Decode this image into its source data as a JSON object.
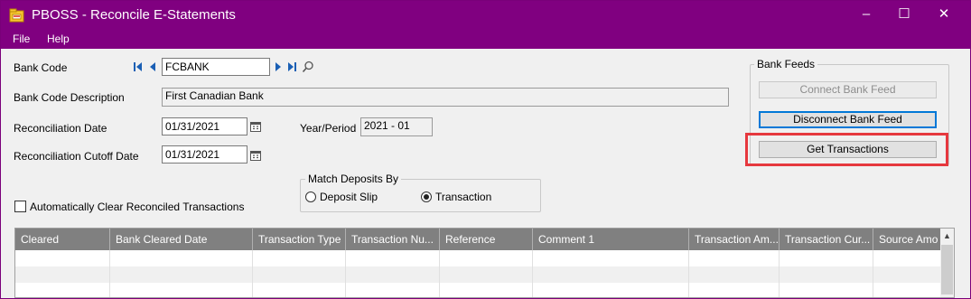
{
  "window": {
    "title": "PBOSS - Reconcile E-Statements",
    "controls": {
      "minimize": "–",
      "maximize": "☐",
      "close": "✕"
    }
  },
  "menu": {
    "file": "File",
    "help": "Help"
  },
  "form": {
    "bank_code_label": "Bank Code",
    "bank_code_value": "FCBANK",
    "bank_code_desc_label": "Bank Code Description",
    "bank_code_desc_value": "First Canadian Bank",
    "recon_date_label": "Reconciliation Date",
    "recon_date_value": "01/31/2021",
    "year_period_label": "Year/Period",
    "year_period_value": "2021 - 01",
    "cutoff_label": "Reconciliation Cutoff Date",
    "cutoff_value": "01/31/2021",
    "auto_clear_label": "Automatically Clear Reconciled Transactions",
    "auto_clear_checked": false
  },
  "match_deposits": {
    "title": "Match Deposits By",
    "options": [
      "Deposit Slip",
      "Transaction"
    ],
    "selected": "Transaction"
  },
  "bank_feeds": {
    "title": "Bank Feeds",
    "connect": "Connect Bank Feed",
    "disconnect": "Disconnect Bank Feed",
    "get_transactions": "Get Transactions"
  },
  "grid": {
    "columns": [
      "Cleared",
      "Bank Cleared Date",
      "Transaction Type",
      "Transaction Nu...",
      "Reference",
      "Comment 1",
      "Transaction Am...",
      "Transaction Cur...",
      "Source Amo"
    ]
  },
  "colors": {
    "titlebar": "#800080",
    "highlight": "#e6383e",
    "focus": "#0078d7",
    "grid_header": "#808080"
  },
  "icons": {
    "app": "app-icon",
    "first": "first-record-icon",
    "prev": "previous-record-icon",
    "next": "next-record-icon",
    "last": "last-record-icon",
    "finder": "finder-magnifier-icon",
    "calendar": "calendar-icon"
  }
}
